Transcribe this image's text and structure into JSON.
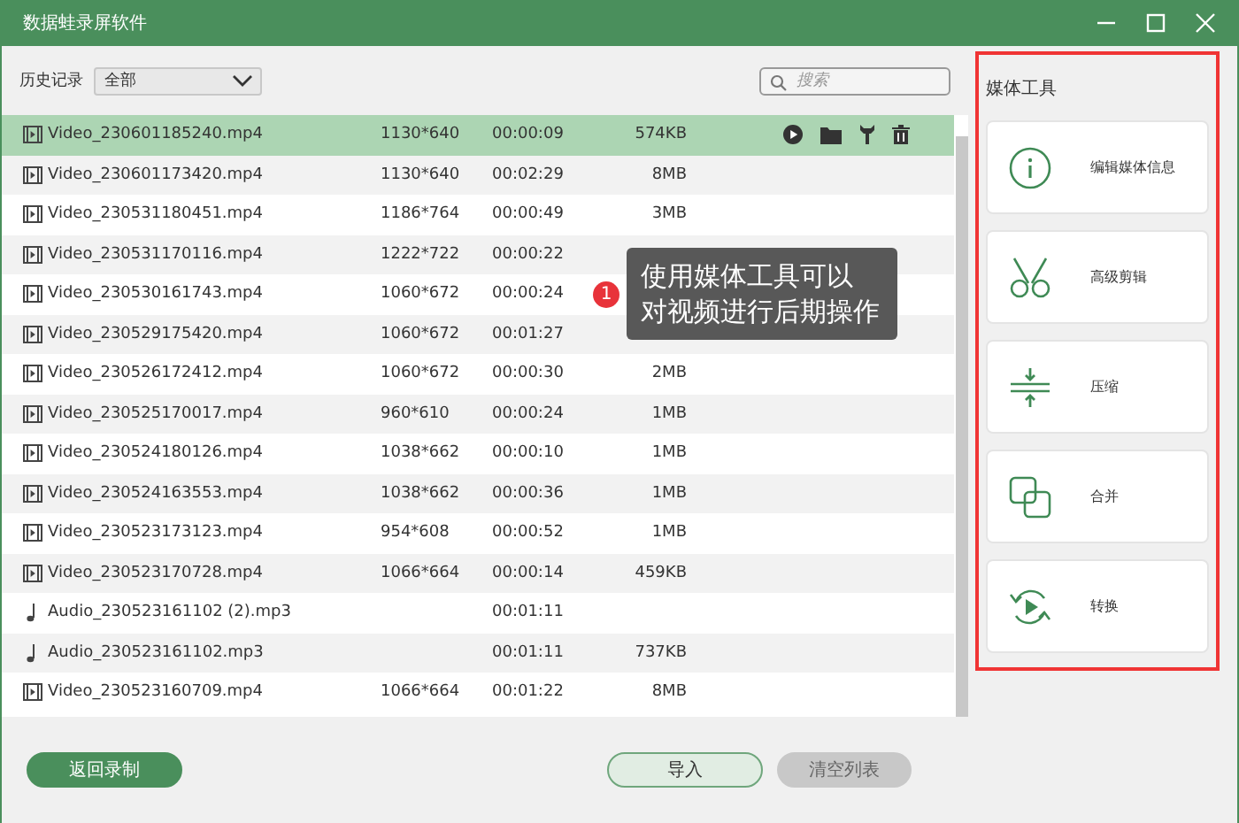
{
  "window": {
    "title": "数据蛙录屏软件"
  },
  "history": {
    "label": "历史记录",
    "filter": "全部",
    "search_placeholder": "搜索"
  },
  "files": [
    {
      "kind": "video",
      "name": "Video_230601185240.mp4",
      "resolution": "1130*640",
      "duration": "00:00:09",
      "size": "574KB",
      "selected": true
    },
    {
      "kind": "video",
      "name": "Video_230601173420.mp4",
      "resolution": "1130*640",
      "duration": "00:02:29",
      "size": "8MB",
      "selected": false
    },
    {
      "kind": "video",
      "name": "Video_230531180451.mp4",
      "resolution": "1186*764",
      "duration": "00:00:49",
      "size": "3MB",
      "selected": false
    },
    {
      "kind": "video",
      "name": "Video_230531170116.mp4",
      "resolution": "1222*722",
      "duration": "00:00:22",
      "selected": false
    },
    {
      "kind": "video",
      "name": "Video_230530161743.mp4",
      "resolution": "1060*672",
      "duration": "00:00:24",
      "selected": false
    },
    {
      "kind": "video",
      "name": "Video_230529175420.mp4",
      "resolution": "1060*672",
      "duration": "00:01:27",
      "selected": false
    },
    {
      "kind": "video",
      "name": "Video_230526172412.mp4",
      "resolution": "1060*672",
      "duration": "00:00:30",
      "size": "2MB",
      "selected": false
    },
    {
      "kind": "video",
      "name": "Video_230525170017.mp4",
      "resolution": "960*610",
      "duration": "00:00:24",
      "size": "1MB",
      "selected": false
    },
    {
      "kind": "video",
      "name": "Video_230524180126.mp4",
      "resolution": "1038*662",
      "duration": "00:00:10",
      "size": "1MB",
      "selected": false
    },
    {
      "kind": "video",
      "name": "Video_230524163553.mp4",
      "resolution": "1038*662",
      "duration": "00:00:36",
      "size": "1MB",
      "selected": false
    },
    {
      "kind": "video",
      "name": "Video_230523173123.mp4",
      "resolution": "954*608",
      "duration": "00:00:52",
      "size": "1MB",
      "selected": false
    },
    {
      "kind": "video",
      "name": "Video_230523170728.mp4",
      "resolution": "1066*664",
      "duration": "00:00:14",
      "size": "459KB",
      "selected": false
    },
    {
      "kind": "audio",
      "name": "Audio_230523161102 (2).mp3",
      "duration": "00:01:11",
      "selected": false
    },
    {
      "kind": "audio",
      "name": "Audio_230523161102.mp3",
      "duration": "00:01:11",
      "size": "737KB",
      "selected": false
    },
    {
      "kind": "video",
      "name": "Video_230523160709.mp4",
      "resolution": "1066*664",
      "duration": "00:01:22",
      "size": "8MB",
      "selected": false
    }
  ],
  "tooltip": {
    "badge": "1",
    "lines": [
      "使用媒体工具可以",
      "对视频进行后期操作"
    ]
  },
  "buttons": {
    "back": "返回录制",
    "import": "导入",
    "clear": "清空列表"
  },
  "media_tools": {
    "title": "媒体工具",
    "items": [
      {
        "kind": "info",
        "label": "编辑媒体信息"
      },
      {
        "kind": "cut",
        "label": "高级剪辑"
      },
      {
        "kind": "compress",
        "label": "压缩"
      },
      {
        "kind": "merge",
        "label": "合并"
      },
      {
        "kind": "convert",
        "label": "转换"
      }
    ]
  }
}
